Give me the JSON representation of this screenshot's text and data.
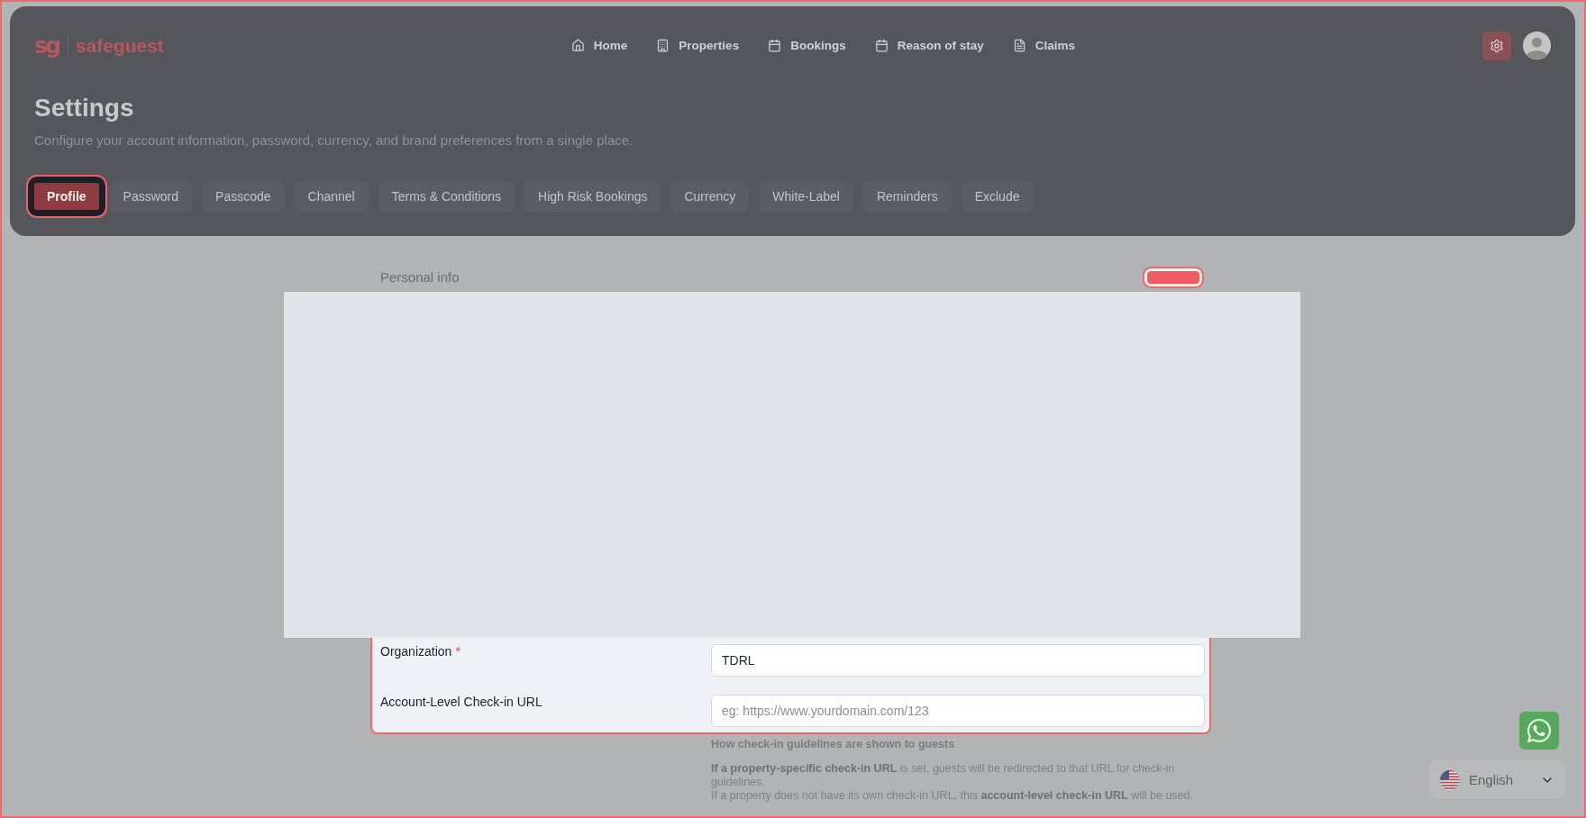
{
  "logo": {
    "mark": "sg",
    "name": "safeguest"
  },
  "nav": [
    {
      "label": "Home"
    },
    {
      "label": "Properties"
    },
    {
      "label": "Bookings"
    },
    {
      "label": "Reason of stay"
    },
    {
      "label": "Claims"
    }
  ],
  "header": {
    "title": "Settings",
    "subtitle": "Configure your account information, password, currency, and brand preferences from a single place."
  },
  "tabs": [
    {
      "label": "Profile",
      "selected": true
    },
    {
      "label": "Password",
      "selected": false
    },
    {
      "label": "Passcode",
      "selected": false
    },
    {
      "label": "Channel",
      "selected": false
    },
    {
      "label": "Terms & Conditions",
      "selected": false
    },
    {
      "label": "High Risk Bookings",
      "selected": false
    },
    {
      "label": "Currency",
      "selected": false
    },
    {
      "label": "White-Label",
      "selected": false
    },
    {
      "label": "Reminders",
      "selected": false
    },
    {
      "label": "Exclude",
      "selected": false
    }
  ],
  "section": {
    "title": "Personal info"
  },
  "form": {
    "required_mark": "*",
    "fields": [
      {
        "label": "Organization",
        "required": true,
        "value": "TDRL"
      },
      {
        "label": "Account-Level Check-in URL",
        "required": false,
        "placeholder": "eg: https://www.yourdomain.com/123"
      }
    ]
  },
  "help": {
    "title": "How check-in guidelines are shown to guests",
    "paragraphs": [
      "**If a property-specific check-in URL** is set, guests will be redirected to that URL for check-in guidelines.",
      "If a property does not have its own check-in URL, this **account-level check-in URL** will be used."
    ]
  },
  "language": {
    "label": "English"
  }
}
